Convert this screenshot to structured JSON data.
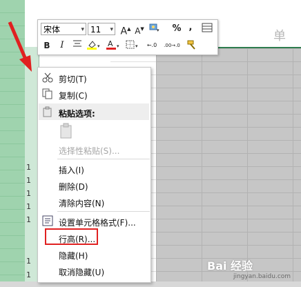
{
  "sheet": {
    "title_fragment": "单",
    "row_numbers": [
      "1",
      "1",
      "1",
      "1",
      "1",
      "1",
      "1"
    ]
  },
  "mini_toolbar": {
    "font_name": "宋体",
    "font_size": "11",
    "buttons": {
      "increase_font": "A",
      "decrease_font": "A",
      "percent": "%",
      "comma": ",",
      "bold": "B",
      "italic": "I",
      "increase_decimal": "←.0",
      "decrease_decimal": ".00→.0"
    },
    "colors": {
      "highlight": "#ffff00",
      "font_color": "#e02020"
    }
  },
  "context_menu": {
    "items": [
      {
        "label": "剪切(T)",
        "icon": "scissors-icon",
        "enabled": true
      },
      {
        "label": "复制(C)",
        "icon": "copy-icon",
        "enabled": true
      },
      {
        "label": "粘贴选项:",
        "icon": "paste-icon",
        "enabled": true,
        "type": "header"
      },
      {
        "label": "选择性粘贴(S)...",
        "enabled": false
      },
      {
        "label": "插入(I)",
        "enabled": true
      },
      {
        "label": "删除(D)",
        "enabled": true
      },
      {
        "label": "清除内容(N)",
        "enabled": true
      },
      {
        "label": "设置单元格格式(F)...",
        "icon": "format-cells-icon",
        "enabled": true
      },
      {
        "label": "行高(R)...",
        "enabled": true,
        "highlighted": true
      },
      {
        "label": "隐藏(H)",
        "enabled": true
      },
      {
        "label": "取消隐藏(U)",
        "enabled": true
      }
    ]
  },
  "watermark": {
    "text": "Bai 经验",
    "url": "jingyan.baidu.com"
  },
  "accent_colors": {
    "annotation_red": "#e02020",
    "excel_green": "#2e7d4f"
  }
}
